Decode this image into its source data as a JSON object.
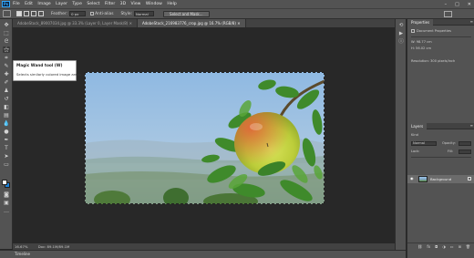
{
  "menu": {
    "logo": "Ps",
    "items": [
      "File",
      "Edit",
      "Image",
      "Layer",
      "Type",
      "Select",
      "Filter",
      "3D",
      "View",
      "Window",
      "Help"
    ],
    "window_controls": {
      "minimize": "–",
      "maximize": "□",
      "close": "✕"
    }
  },
  "options": {
    "feather_label": "Feather:",
    "feather_value": "0 px",
    "antialias_label": "Anti-alias",
    "style_label": "Style:",
    "style_value": "Normal",
    "select_mask_label": "Select and Mask..."
  },
  "tabs": [
    "AdobeStock_89007034.jpg @ 33.3% (Layer 0, Layer Mask/8) ✕",
    "AdobeStock_216983776_crop.jpg @ 16.7% (RGB/8) ✕"
  ],
  "tooltip": {
    "title": "Magic Wand tool (W)",
    "description": "Selects similarly colored image areas"
  },
  "status": {
    "zoom": "16.67%",
    "doc_info": "Doc: 89.1M/89.1M"
  },
  "timeline": {
    "label": "Timeline"
  },
  "properties": {
    "tab": "Properties",
    "section": "Document Properties",
    "width_label": "W: 98.77 cm",
    "height_label": "H: 56.02 cm",
    "resolution_label": "Resolution: 300 pixels/inch"
  },
  "layers": {
    "tab": "Layers",
    "kind_label": "Kind",
    "blend_mode": "Normal",
    "opacity_label": "Opacity:",
    "lock_label": "Lock:",
    "fill_label": "Fill:",
    "layer_name": "Background"
  },
  "colors": {
    "accent": "#31a8ff",
    "foreground": "#ffffff",
    "background_swatch": "#1b7fd6",
    "chrome": "#535353",
    "canvas": "#282828"
  }
}
